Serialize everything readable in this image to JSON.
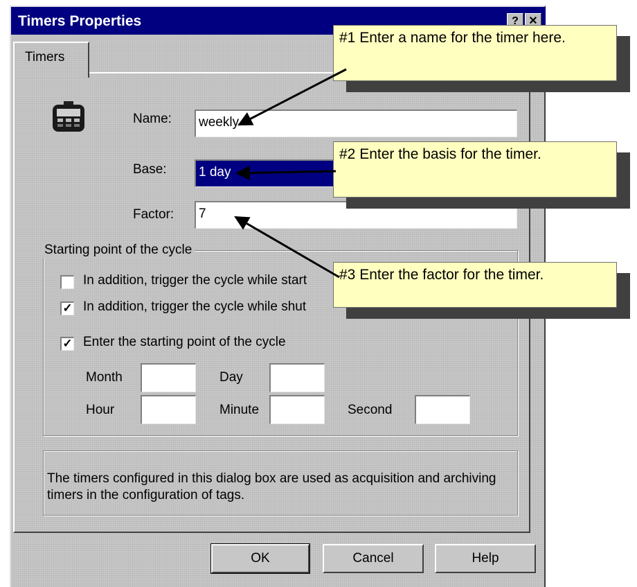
{
  "window": {
    "title": "Timers Properties",
    "help_button": "?",
    "close_button": "✕"
  },
  "tabs": [
    {
      "label": "Timers"
    }
  ],
  "form": {
    "name_label": "Name:",
    "name_value": "weekly",
    "base_label": "Base:",
    "base_value": "1 day",
    "factor_label": "Factor:",
    "factor_value": "7"
  },
  "starting_point": {
    "group_label": "Starting point of the cycle",
    "check_startup": {
      "label": "In addition, trigger the cycle while start",
      "checked": false
    },
    "check_shutdown": {
      "label": "In addition, trigger the cycle while shut",
      "checked": true
    },
    "check_enter": {
      "label": "Enter the starting point of the cycle",
      "checked": true
    },
    "month_label": "Month",
    "day_label": "Day",
    "hour_label": "Hour",
    "minute_label": "Minute",
    "second_label": "Second",
    "month_value": "",
    "day_value": "",
    "hour_value": "",
    "minute_value": "",
    "second_value": ""
  },
  "info_text": "The timers configured in this dialog box are used as acquisition and archiving timers in the configuration of tags.",
  "buttons": {
    "ok": "OK",
    "cancel": "Cancel",
    "help": "Help"
  },
  "callouts": {
    "c1": "#1  Enter a name for the timer here.",
    "c2": "#2  Enter the basis for the timer.",
    "c3": "#3  Enter the factor for the timer."
  },
  "colors": {
    "title_bar": "#000080",
    "callout_bg": "#ffffc0",
    "dialog_bg": "#c7c7c7"
  }
}
